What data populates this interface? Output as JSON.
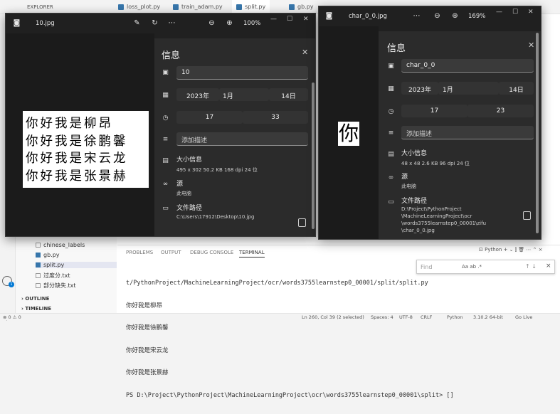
{
  "vscode": {
    "explorer_title": "EXPLORER",
    "tabs": [
      "loss_plot.py",
      "train_adam.py",
      "split.py",
      "gb.py"
    ],
    "sidebar_items": [
      {
        "label": "chinese_labels",
        "kind": "folder"
      },
      {
        "label": "gb.py",
        "kind": "py"
      },
      {
        "label": "split.py",
        "kind": "py"
      },
      {
        "label": "过度分.txt",
        "kind": "txt"
      },
      {
        "label": "部分缺失.txt",
        "kind": "txt"
      }
    ],
    "sections": [
      "OUTLINE",
      "TIMELINE"
    ],
    "panel_tabs": [
      "PROBLEMS",
      "OUTPUT",
      "DEBUG CONSOLE",
      "TERMINAL"
    ],
    "panel_python": "Python",
    "terminal_lines": [
      "t/PythonProject/MachineLearningProject/ocr/words3755learnstep0_00001/split/split.py",
      "你好我是柳昂",
      "你好我是徐鹏馨",
      "你好我是宋云龙",
      "你好我是张景赫",
      "PS D:\\Project\\PythonProject\\MachineLearningProject\\ocr\\words3755learnstep0_00001\\split> []"
    ],
    "find_placeholder": "Find",
    "find_options": "Aa  ab  .*",
    "status": {
      "errors": "⊗ 0 ⚠ 0",
      "position": "Ln 260, Col 39 (2 selected)",
      "spaces": "Spaces: 4",
      "encoding": "UTF-8",
      "eol": "CRLF",
      "language": "Python",
      "interpreter": "3.10.2 64-bit",
      "golive": "Go Live"
    }
  },
  "viewer1": {
    "title": "10.jpg",
    "zoom": "100%",
    "info_title": "信息",
    "name_value": "10",
    "date_year": "2023年",
    "date_month": "1月",
    "date_day": "14日",
    "time_hour": "17",
    "time_minute": "33",
    "desc_placeholder": "添加描述",
    "size_title": "大小信息",
    "size_details": "495 x 302    50.2 KB    168 dpi    24 位",
    "source_title": "源",
    "source_value": "此电脑",
    "path_title": "文件路径",
    "path_value": "C:\\Users\\17912\\Desktop\\10.jpg",
    "image_lines": [
      "你好我是柳昂",
      "你好我是徐鹏馨",
      "你好我是宋云龙",
      "你好我是张景赫"
    ]
  },
  "viewer2": {
    "title": "char_0_0.jpg",
    "zoom": "169%",
    "info_title": "信息",
    "name_value": "char_0_0",
    "date_year": "2023年",
    "date_month": "1月",
    "date_day": "14日",
    "time_hour": "17",
    "time_minute": "23",
    "desc_placeholder": "添加描述",
    "size_title": "大小信息",
    "size_details": "48 x 48    2.6 KB    96 dpi    24 位",
    "source_title": "源",
    "source_value": "此电脑",
    "path_title": "文件路径",
    "path_lines": [
      "D:\\Project\\PythonProject",
      "\\MachineLearningProject\\ocr",
      "\\words3755learnstep0_00001\\zifu",
      "\\char_0_0.jpg"
    ],
    "image_char": "你"
  }
}
